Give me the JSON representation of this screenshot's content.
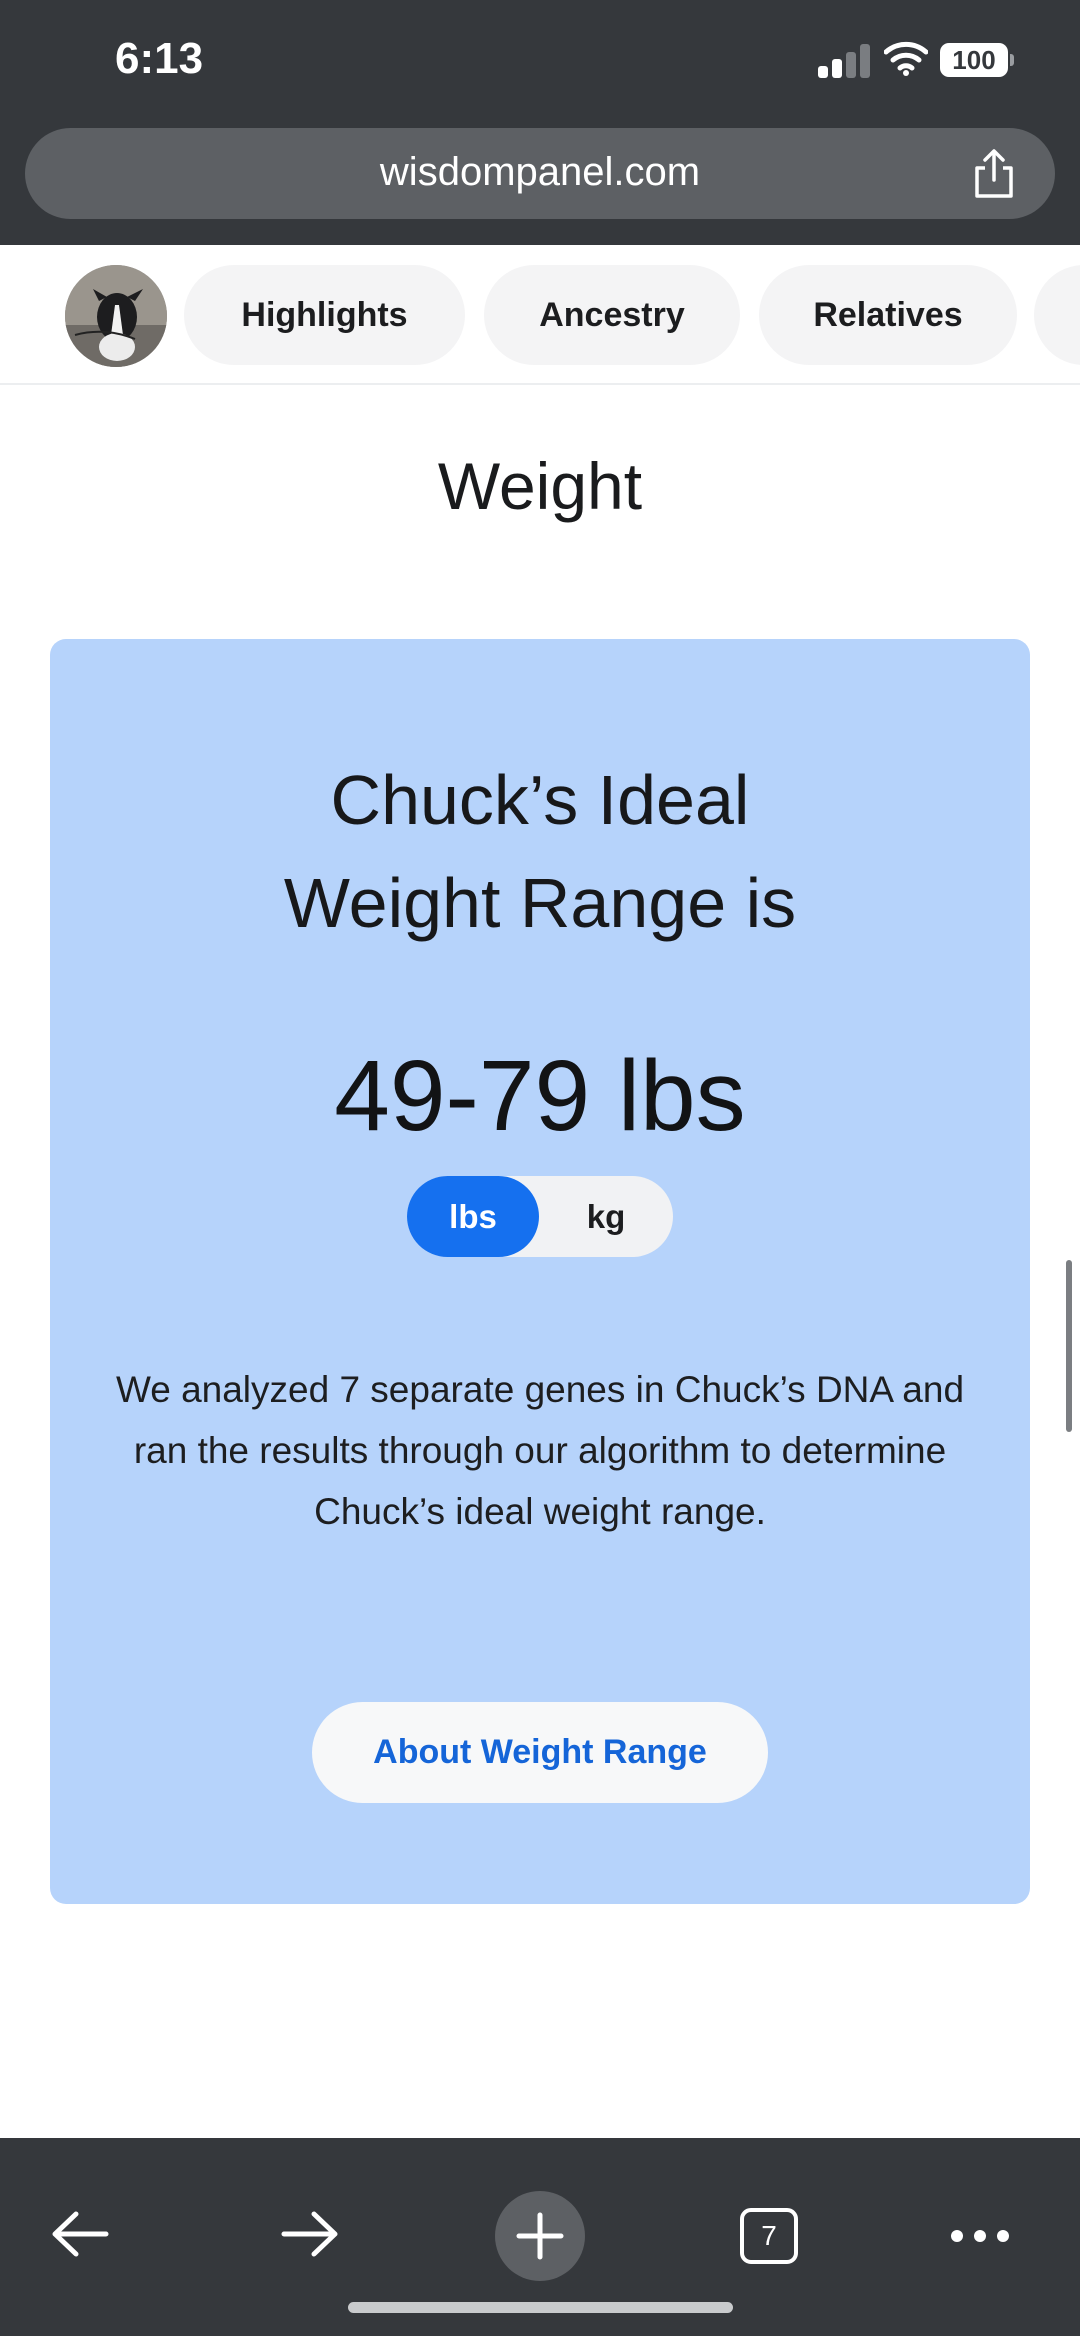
{
  "status_bar": {
    "time": "6:13",
    "battery": "100"
  },
  "browser": {
    "url": "wisdompanel.com",
    "tab_count": "7"
  },
  "nav": {
    "tabs": [
      {
        "label": "Highlights"
      },
      {
        "label": "Ancestry"
      },
      {
        "label": "Relatives"
      }
    ]
  },
  "section": {
    "title": "Weight"
  },
  "weight_card": {
    "heading_line1": "Chuck’s Ideal",
    "heading_line2": "Weight Range is",
    "value": "49-79 lbs",
    "units": {
      "selected": "lbs",
      "options": [
        "lbs",
        "kg"
      ]
    },
    "description": "We analyzed 7 separate genes in Chuck’s DNA and ran the results through our algorithm to determine Chuck’s ideal weight range.",
    "button_label": "About Weight Range"
  },
  "colors": {
    "chrome": "#35383c",
    "card_background": "#b6d3fb",
    "toggle_active": "#1570ef",
    "link_blue": "#1565d8"
  }
}
